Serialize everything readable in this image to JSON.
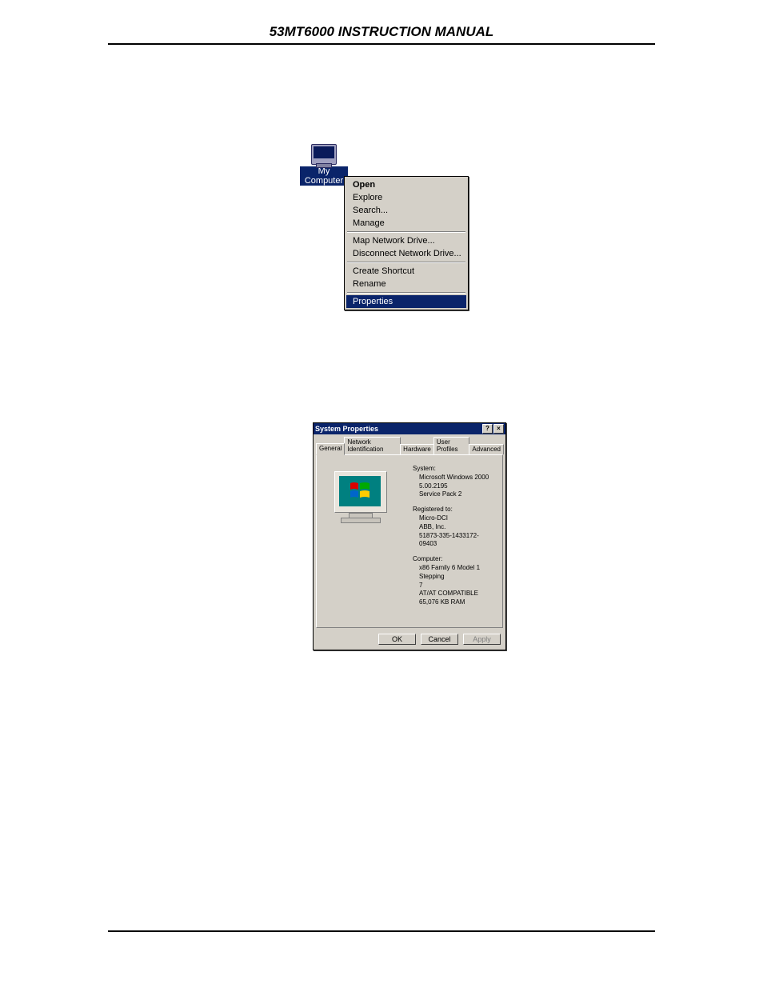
{
  "page": {
    "title": "53MT6000 INSTRUCTION MANUAL"
  },
  "desktop_icon": {
    "label": "My Computer"
  },
  "context_menu": {
    "items": [
      {
        "label": "Open",
        "bold": true
      },
      {
        "label": "Explore"
      },
      {
        "label": "Search..."
      },
      {
        "label": "Manage"
      },
      {
        "sep": true
      },
      {
        "label": "Map Network Drive..."
      },
      {
        "label": "Disconnect Network Drive..."
      },
      {
        "sep": true
      },
      {
        "label": "Create Shortcut"
      },
      {
        "label": "Rename"
      },
      {
        "sep": true
      },
      {
        "label": "Properties",
        "selected": true
      }
    ]
  },
  "dialog": {
    "title": "System Properties",
    "help": "?",
    "close": "×",
    "tabs": [
      "General",
      "Network Identification",
      "Hardware",
      "User Profiles",
      "Advanced"
    ],
    "active_tab": 0,
    "system": {
      "header": "System:",
      "lines": [
        "Microsoft Windows 2000",
        "5.00.2195",
        "Service Pack 2"
      ]
    },
    "registered": {
      "header": "Registered to:",
      "lines": [
        "Micro-DCI",
        "ABB, Inc.",
        "51873-335-1433172-09403"
      ]
    },
    "computer": {
      "header": "Computer:",
      "lines": [
        "x86 Family 6 Model 1 Stepping",
        "7",
        "AT/AT COMPATIBLE",
        "65,076 KB RAM"
      ]
    },
    "buttons": {
      "ok": "OK",
      "cancel": "Cancel",
      "apply": "Apply"
    }
  }
}
